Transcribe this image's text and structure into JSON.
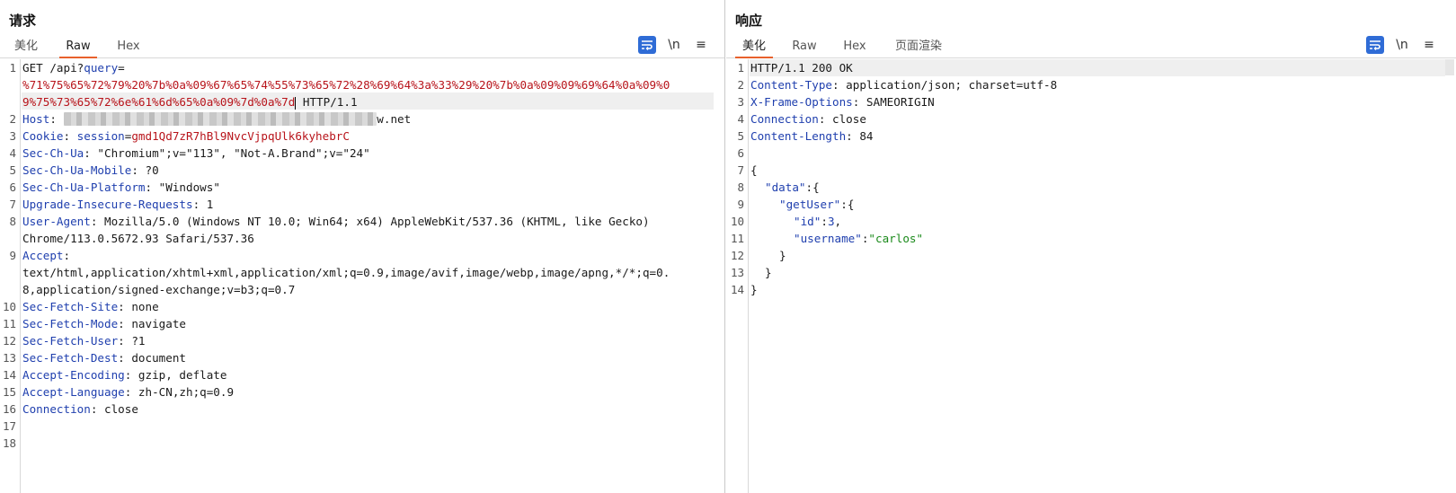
{
  "request": {
    "title": "请求",
    "tabs": [
      "美化",
      "Raw",
      "Hex"
    ],
    "active_tab": "Raw",
    "line_numbers": [
      "1",
      "2",
      "3",
      "4",
      "5",
      "6",
      "7",
      "8",
      "9",
      "10",
      "11",
      "12",
      "13",
      "14",
      "15",
      "16",
      "17",
      "18"
    ],
    "line1_method": "GET /api?",
    "line1_param": "query",
    "line1_eq": "=",
    "query_part1": "%71%75%65%72%79%20%7b%0a%09%67%65%74%55%73%65%72%28%69%64%3a%33%29%20%7b%0a%09%09%69%64%0a%09%0",
    "query_part2": "9%75%73%65%72%6e%61%6d%65%0a%09%7d%0a%7d",
    "line1_proto": " HTTP/1.1",
    "host_key": "Host",
    "host_blurred": "xxxxxxxxxxxxxxxxxxxxxxxxxxxxxxxxxxxxxxxxxxxxxx",
    "host_suffix": "w.net",
    "cookie_key": "Cookie",
    "cookie_name": "session",
    "cookie_value": "gmd1Qd7zR7hBl9NvcVjpqUlk6kyhebrC",
    "headers": [
      {
        "k": "Sec-Ch-Ua",
        "v": "\"Chromium\";v=\"113\", \"Not-A.Brand\";v=\"24\""
      },
      {
        "k": "Sec-Ch-Ua-Mobile",
        "v": "?0"
      },
      {
        "k": "Sec-Ch-Ua-Platform",
        "v": "\"Windows\""
      },
      {
        "k": "Upgrade-Insecure-Requests",
        "v": "1"
      }
    ],
    "ua_key": "User-Agent",
    "ua_value_1": "Mozilla/5.0 (Windows NT 10.0; Win64; x64) AppleWebKit/537.36 (KHTML, like Gecko)",
    "ua_value_2": "Chrome/113.0.5672.93 Safari/537.36",
    "accept_key": "Accept",
    "accept_value_1": "text/html,application/xhtml+xml,application/xml;q=0.9,image/avif,image/webp,image/apng,*/*;q=0.",
    "accept_value_2": "8,application/signed-exchange;v=b3;q=0.7",
    "headers2": [
      {
        "k": "Sec-Fetch-Site",
        "v": "none"
      },
      {
        "k": "Sec-Fetch-Mode",
        "v": "navigate"
      },
      {
        "k": "Sec-Fetch-User",
        "v": "?1"
      },
      {
        "k": "Sec-Fetch-Dest",
        "v": "document"
      },
      {
        "k": "Accept-Encoding",
        "v": "gzip, deflate"
      },
      {
        "k": "Accept-Language",
        "v": "zh-CN,zh;q=0.9"
      },
      {
        "k": "Connection",
        "v": "close"
      }
    ]
  },
  "response": {
    "title": "响应",
    "tabs": [
      "美化",
      "Raw",
      "Hex",
      "页面渲染"
    ],
    "active_tab": "美化",
    "line_numbers": [
      "1",
      "2",
      "3",
      "4",
      "5",
      "6",
      "7",
      "8",
      "9",
      "10",
      "11",
      "12",
      "13",
      "14"
    ],
    "status_line": "HTTP/1.1 200 OK",
    "headers": [
      {
        "k": "Content-Type",
        "v": "application/json; charset=utf-8"
      },
      {
        "k": "X-Frame-Options",
        "v": "SAMEORIGIN"
      },
      {
        "k": "Connection",
        "v": "close"
      },
      {
        "k": "Content-Length",
        "v": "84"
      }
    ],
    "json": {
      "open": "{",
      "data_key": "\"data\"",
      "getUser_key": "\"getUser\"",
      "id_key": "\"id\"",
      "id_val": "3",
      "username_key": "\"username\"",
      "username_val": "\"carlos\"",
      "colon_open": ":{",
      "colon": ":",
      "comma": ",",
      "close": "}"
    }
  },
  "toolbar": {
    "newline_label": "\\n",
    "menu_label": "≡"
  },
  "colors": {
    "accent": "#e8612c",
    "active_button": "#2f6cd6",
    "header_key": "#1f3fae",
    "param_value": "#b8141b",
    "json_string": "#1b8a1b"
  },
  "icons": [
    "wrap-lines-icon",
    "newline-icon",
    "menu-icon",
    "split-horizontal-icon",
    "split-vertical-icon",
    "single-pane-icon"
  ]
}
